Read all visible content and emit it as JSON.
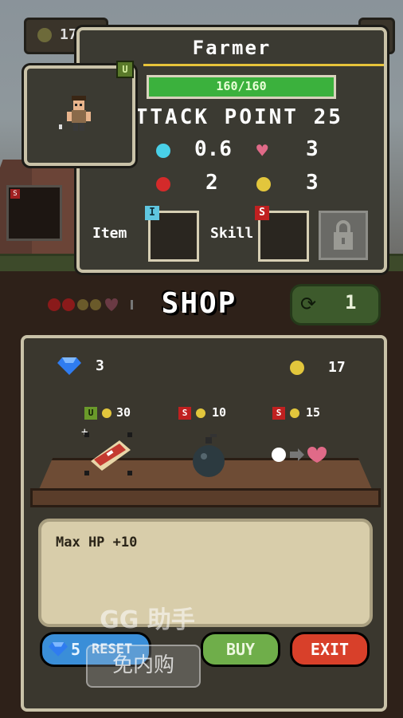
{
  "hud": {
    "coins": "17"
  },
  "character": {
    "name": "Farmer",
    "hp_text": "160/160",
    "hp_fraction": 1.0,
    "attack_label": "ATTACK POINT 25",
    "stats": {
      "cyan_value": "0.6",
      "heart_value": "3",
      "red_value": "2",
      "gold_value": "3"
    },
    "item_label": "Item",
    "skill_label": "Skill",
    "item_badge": "I",
    "skill_badge": "S",
    "upgrade_badge": "U"
  },
  "shop": {
    "title": "SHOP",
    "refresh_count": "1",
    "gems": "3",
    "coins": "17",
    "items": [
      {
        "badge": "U",
        "badge_color": "#6a9a2a",
        "price": "30",
        "name": "meat-card"
      },
      {
        "badge": "S",
        "badge_color": "#c02020",
        "price": "10",
        "name": "bomb"
      },
      {
        "badge": "S",
        "badge_color": "#c02020",
        "price": "15",
        "name": "orb-to-heart"
      }
    ],
    "description": "Max HP +10",
    "buttons": {
      "reset_count": "5",
      "reset_label": "RESET",
      "buy_label": "BUY",
      "exit_label": "EXIT"
    }
  },
  "colors": {
    "hp_green": "#3bb13d",
    "cyan": "#49d0e8",
    "heart": "#e06a88",
    "red": "#d42a2a",
    "gold": "#e2c63c"
  },
  "watermark": {
    "line1": "GG 助手",
    "line2": "免内购"
  }
}
